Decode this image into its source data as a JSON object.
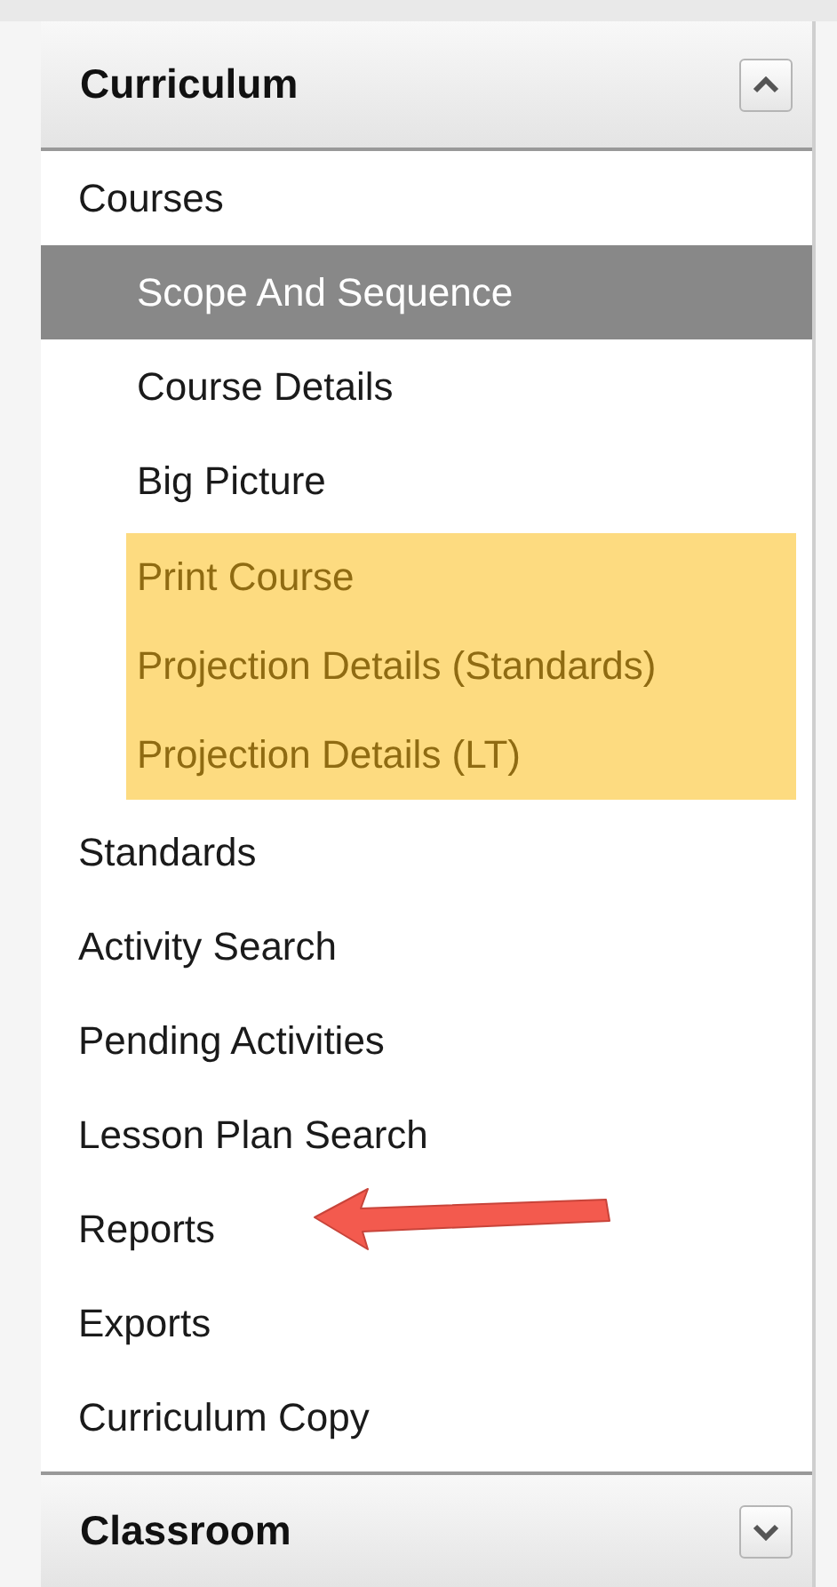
{
  "sections": [
    {
      "title": "Curriculum",
      "expanded": true,
      "items": [
        {
          "label": "Courses",
          "selected": false,
          "pointed": false,
          "children": [
            {
              "label": "Scope And Sequence",
              "selected": true,
              "highlighted": false
            },
            {
              "label": "Course Details",
              "selected": false,
              "highlighted": false
            },
            {
              "label": "Big Picture",
              "selected": false,
              "highlighted": false
            },
            {
              "label": "Print Course",
              "selected": false,
              "highlighted": true
            },
            {
              "label": "Projection Details (Standards)",
              "selected": false,
              "highlighted": true
            },
            {
              "label": "Projection Details (LT)",
              "selected": false,
              "highlighted": true
            }
          ]
        },
        {
          "label": "Standards",
          "selected": false,
          "pointed": false
        },
        {
          "label": "Activity Search",
          "selected": false,
          "pointed": false
        },
        {
          "label": "Pending Activities",
          "selected": false,
          "pointed": false
        },
        {
          "label": "Lesson Plan Search",
          "selected": false,
          "pointed": false
        },
        {
          "label": "Reports",
          "selected": false,
          "pointed": true
        },
        {
          "label": "Exports",
          "selected": false,
          "pointed": false
        },
        {
          "label": "Curriculum Copy",
          "selected": false,
          "pointed": false
        }
      ]
    },
    {
      "title": "Classroom",
      "expanded": false
    }
  ]
}
